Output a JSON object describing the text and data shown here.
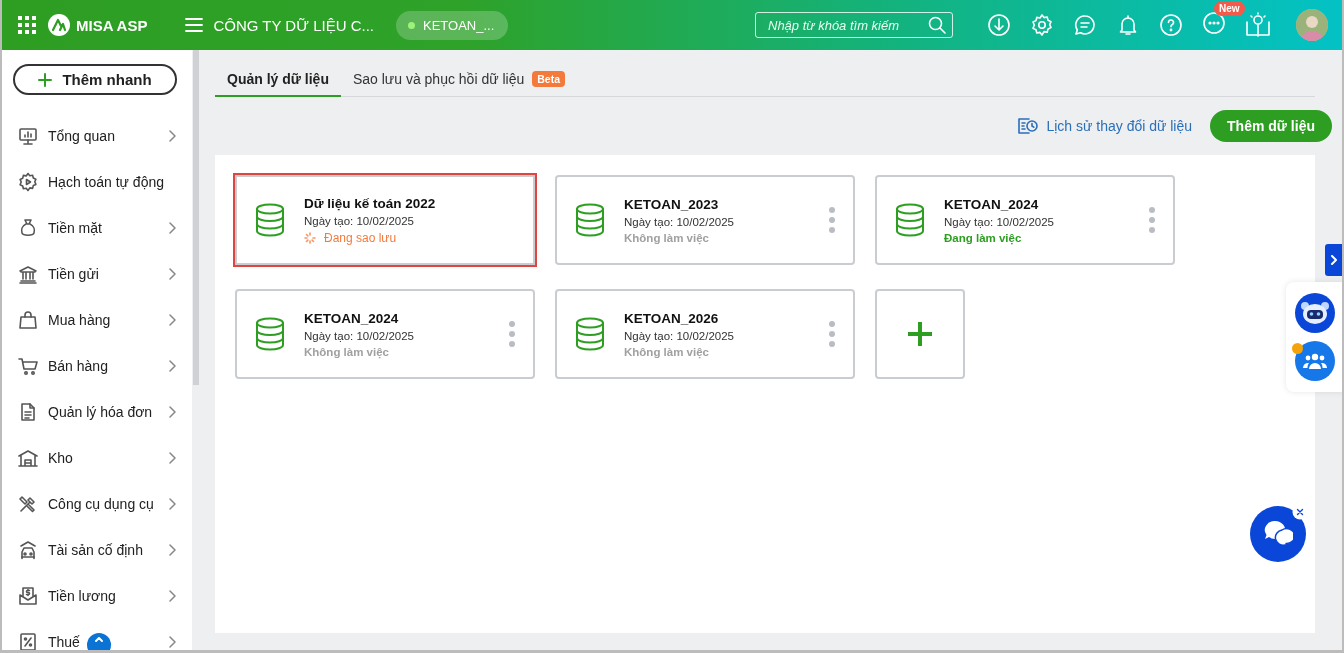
{
  "header": {
    "app_name": "MISA ASP",
    "company": "CÔNG TY DỮ LIỆU C...",
    "database": "KETOAN_...",
    "search": {
      "placeholder": "Nhập từ khóa tìm kiếm"
    },
    "new_badge": "New"
  },
  "sidebar": {
    "quick_add": "Thêm nhanh",
    "items": [
      {
        "label": "Tổng quan",
        "has_submenu": true
      },
      {
        "label": "Hạch toán tự động",
        "has_submenu": false
      },
      {
        "label": "Tiền mặt",
        "has_submenu": true
      },
      {
        "label": "Tiền gửi",
        "has_submenu": true
      },
      {
        "label": "Mua hàng",
        "has_submenu": true
      },
      {
        "label": "Bán hàng",
        "has_submenu": true
      },
      {
        "label": "Quản lý hóa đơn",
        "has_submenu": true
      },
      {
        "label": "Kho",
        "has_submenu": true
      },
      {
        "label": "Công cụ dụng cụ",
        "has_submenu": true
      },
      {
        "label": "Tài sản cố định",
        "has_submenu": true
      },
      {
        "label": "Tiền lương",
        "has_submenu": true
      },
      {
        "label": "Thuế",
        "has_submenu": true
      }
    ]
  },
  "tabs": [
    {
      "label": "Quản lý dữ liệu",
      "selected": true
    },
    {
      "label": "Sao lưu và phục hồi dữ liệu",
      "selected": false,
      "badge": "Beta"
    }
  ],
  "history_link": "Lịch sử thay đổi dữ liệu",
  "add_button": "Thêm dữ liệu",
  "databases": [
    {
      "name": "Dữ liệu kế toán 2022",
      "created": "Ngày tạo: 10/02/2025",
      "status": "Đang sao lưu",
      "kind": "progress",
      "color": "#f47a3c",
      "selected": true,
      "has_menu": false
    },
    {
      "name": "KETOAN_2023",
      "created": "Ngày tạo: 10/02/2025",
      "status": "Không làm việc",
      "kind": "plain",
      "color": "#a0a0a0",
      "selected": false,
      "has_menu": true
    },
    {
      "name": "KETOAN_2024",
      "created": "Ngày tạo: 10/02/2025",
      "status": "Đang làm việc",
      "kind": "plain",
      "color": "#2d9e22",
      "selected": false,
      "has_menu": true
    },
    {
      "name": "KETOAN_2024",
      "created": "Ngày tạo: 10/02/2025",
      "status": "Không làm việc",
      "kind": "plain",
      "color": "#a0a0a0",
      "selected": false,
      "has_menu": true
    },
    {
      "name": "KETOAN_2026",
      "created": "Ngày tạo: 10/02/2025",
      "status": "Không làm việc",
      "kind": "plain",
      "color": "#a0a0a0",
      "selected": false,
      "has_menu": true
    }
  ]
}
